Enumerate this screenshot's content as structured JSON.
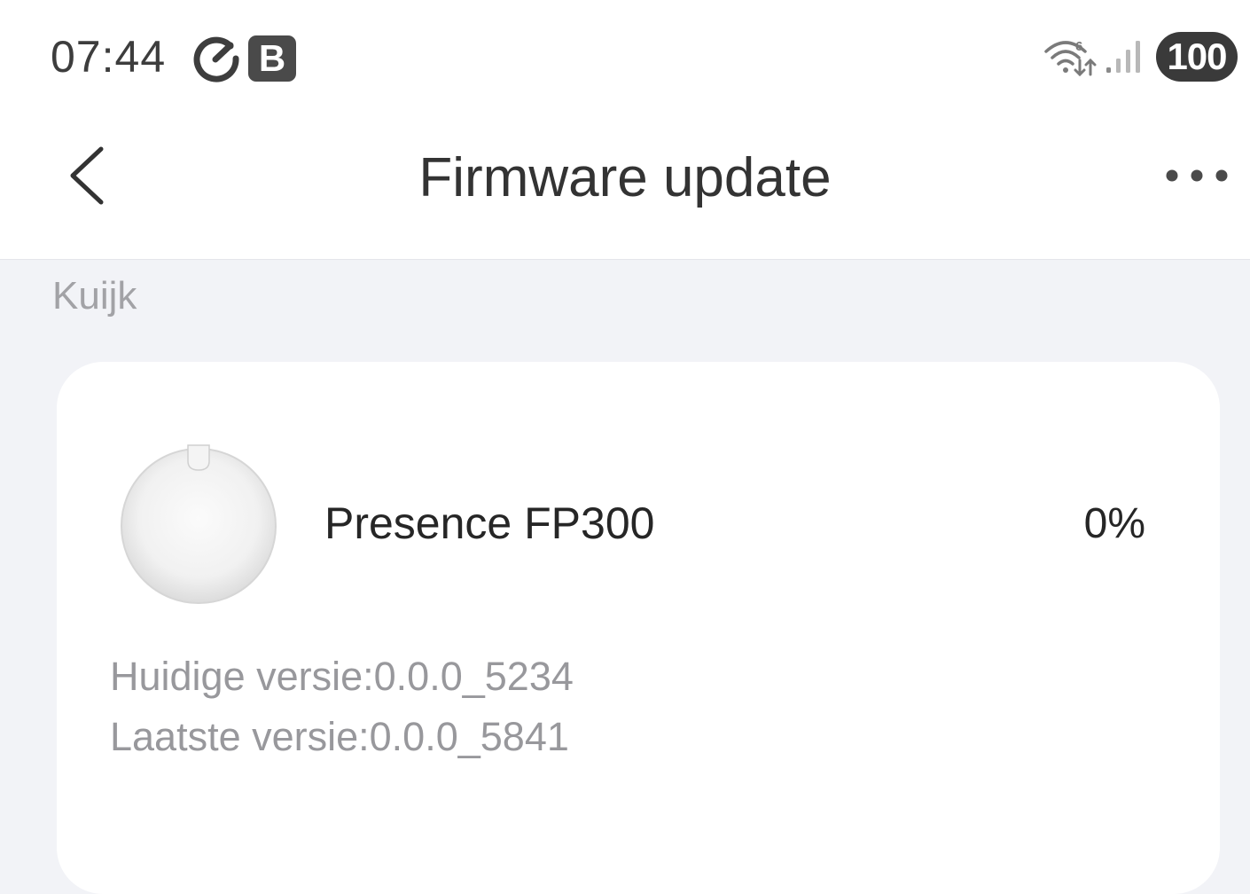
{
  "status_bar": {
    "time": "07:44",
    "badge_letter": "B",
    "battery_level": "100",
    "icons": [
      "sync-icon",
      "wifi-6-icon",
      "cell-signal-icon",
      "battery-icon"
    ]
  },
  "nav": {
    "title": "Firmware update",
    "back_icon": "chevron-left-icon",
    "more_icon": "more-horizontal-icon"
  },
  "section": {
    "label": "Kuijk"
  },
  "device": {
    "name": "Presence FP300",
    "progress": "0%",
    "current_version_label": "Huidige versie:",
    "current_version_value": "0.0.0_5234",
    "latest_version_label": "Laatste versie:",
    "latest_version_value": "0.0.0_5841",
    "image_icon": "presence-sensor-device-image"
  },
  "colors": {
    "background": "#f2f3f7",
    "card": "#ffffff",
    "title_text": "#333333",
    "secondary_text": "#98989c"
  }
}
